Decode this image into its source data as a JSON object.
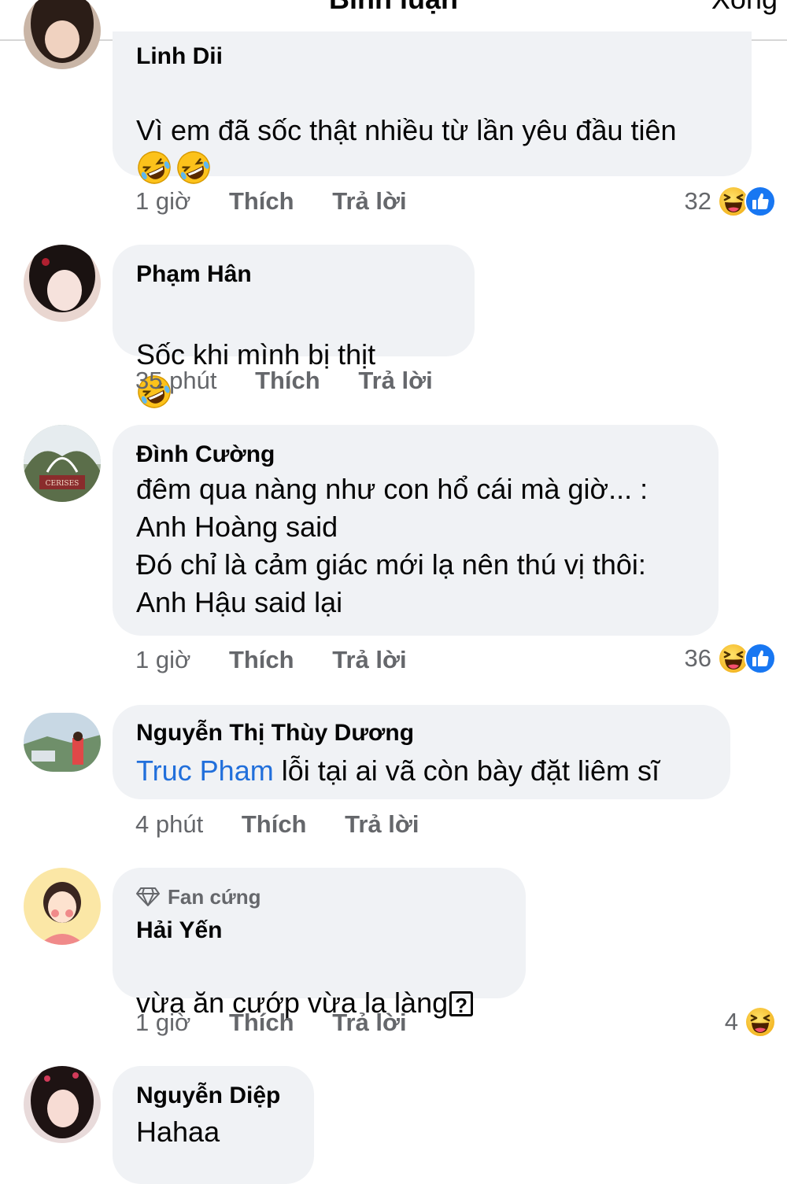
{
  "header": {
    "title": "Bình luận",
    "done_label": "Xong"
  },
  "comments": [
    {
      "author": "Linh Dii",
      "text": "Vì em đã sốc thật nhiều từ lần yêu đầu tiên",
      "time": "1 giờ",
      "like_label": "Thích",
      "reply_label": "Trả lời",
      "reaction_count": "32",
      "reactions": [
        "haha-icon",
        "like-icon"
      ]
    },
    {
      "author": "Phạm Hân",
      "text": "Sốc khi mình bị thịt",
      "time": "35 phút",
      "like_label": "Thích",
      "reply_label": "Trả lời"
    },
    {
      "author": "Đình Cường",
      "text": "đêm qua nàng như con hổ cái mà giờ... :\nAnh Hoàng said\nĐó chỉ là cảm giác mới lạ nên thú vị thôi:\nAnh Hậu said lại",
      "avatar_text": "CERISES",
      "time": "1 giờ",
      "like_label": "Thích",
      "reply_label": "Trả lời",
      "reaction_count": "36",
      "reactions": [
        "haha-icon",
        "like-icon"
      ]
    },
    {
      "author": "Nguyễn Thị Thùy Dương",
      "mention": "Truc Pham",
      "text": " lỗi tại ai vã còn bày đặt liêm sĩ",
      "time": "4 phút",
      "like_label": "Thích",
      "reply_label": "Trả lời"
    },
    {
      "badge": "Fan cứng",
      "author": "Hải Yến",
      "text": "vừa ăn cướp vừa la làng",
      "unknown_glyph": "?",
      "time": "1 giờ",
      "like_label": "Thích",
      "reply_label": "Trả lời",
      "reaction_count": "4",
      "reactions": [
        "haha-icon"
      ]
    },
    {
      "author": "Nguyễn Diệp",
      "text": "Hahaa"
    }
  ],
  "colors": {
    "bubble": "#f0f2f5",
    "meta_text": "#65676b",
    "mention": "#216fdb",
    "like_blue": "#1877f2",
    "haha_yellow": "#f7c634"
  }
}
